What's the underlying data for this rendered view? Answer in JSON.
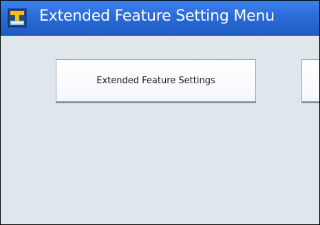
{
  "window": {
    "title": "Extended Feature Setting Menu",
    "title_icon": "extended-feature-menu-icon"
  },
  "menu": {
    "items": [
      {
        "label": "Extended Feature Settings"
      },
      {
        "label": ""
      }
    ]
  },
  "colors": {
    "titlebar": "#2a6bd6",
    "background": "#dfe6ec",
    "button_face": "#ffffff",
    "button_border": "#9aa9bd"
  }
}
